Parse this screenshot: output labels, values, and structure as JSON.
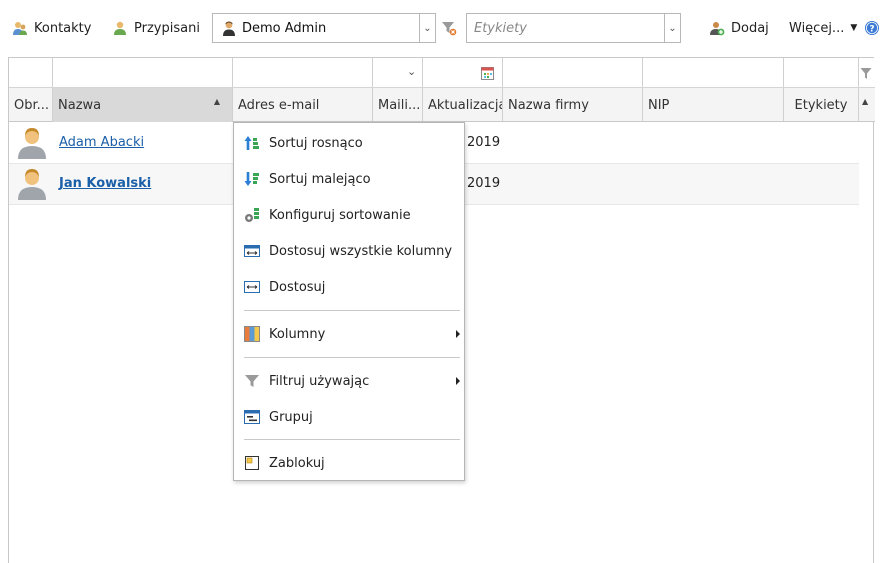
{
  "toolbar": {
    "contacts_label": "Kontakty",
    "assigned_label": "Przypisani",
    "owner_value": "Demo Admin",
    "tags_placeholder": "Etykiety",
    "add_label": "Dodaj",
    "more_label": "Więcej..."
  },
  "grid": {
    "columns": [
      "Obr...",
      "Nazwa",
      "Adres e-mail",
      "Maili...",
      "Aktualizacja",
      "Nazwa firmy",
      "NIP",
      "Etykiety"
    ],
    "rows": [
      {
        "name": "Adam Abacki",
        "date": "2019"
      },
      {
        "name": "Jan Kowalski",
        "date": "2019"
      }
    ]
  },
  "context_menu": {
    "items": [
      {
        "label": "Sortuj rosnąco",
        "icon": "sort-asc-icon"
      },
      {
        "label": "Sortuj malejąco",
        "icon": "sort-desc-icon"
      },
      {
        "label": "Konfiguruj sortowanie",
        "icon": "sort-config-icon"
      },
      {
        "label": "Dostosuj wszystkie kolumny",
        "icon": "fit-all-columns-icon"
      },
      {
        "label": "Dostosuj",
        "icon": "fit-column-icon"
      },
      {
        "label": "Kolumny",
        "icon": "columns-icon"
      },
      {
        "label": "Filtruj używając",
        "icon": "filter-icon"
      },
      {
        "label": "Grupuj",
        "icon": "group-icon"
      },
      {
        "label": "Zablokuj",
        "icon": "freeze-icon"
      }
    ]
  },
  "colors": {
    "link": "#1a5fa8",
    "header_bg": "#f4f4f4",
    "active_header_bg": "#d9d9d9"
  }
}
